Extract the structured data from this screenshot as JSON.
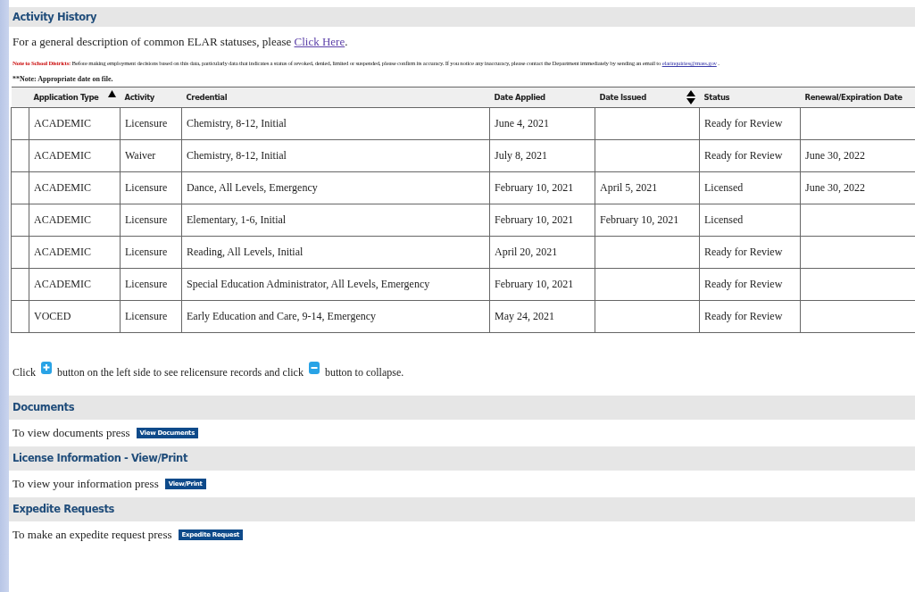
{
  "activity_history": {
    "title": "Activity History",
    "intro": {
      "text": "For a general description of common ELAR statuses, please",
      "link": "Click Here",
      "after": "."
    },
    "note": {
      "label": "Note to School Districts:",
      "text": "Before making employment decisions based on this data, particularly data that indicates a status of revoked, denied, limited or suspended, please confirm its accuracy. If you notice any inaccuracy, please contact the Department immediately by sending an email to",
      "email": "elarinquiries@mass.gov",
      "after": "."
    },
    "date_note": "**Note: Appropriate date on file.",
    "table": {
      "columns": [
        {
          "label": "Application Type",
          "sorted": true
        },
        {
          "label": "Activity",
          "sorted": false,
          "sortable": false
        },
        {
          "label": "Credential",
          "sorted": false,
          "sortable": false
        },
        {
          "label": "Date Applied",
          "sorted": false,
          "sortable": false
        },
        {
          "label": "Date Issued",
          "sorted": false,
          "sortable": true
        },
        {
          "label": "Status",
          "sorted": false,
          "sortable": false
        },
        {
          "label": "Renewal/Expiration Date",
          "sorted": false,
          "sortable": false
        }
      ],
      "rows": [
        [
          "ACADEMIC",
          "Licensure",
          "Chemistry, 8-12, Initial",
          "June 4, 2021",
          "",
          "Ready for Review",
          ""
        ],
        [
          "ACADEMIC",
          "Waiver",
          "Chemistry, 8-12, Initial",
          "July 8, 2021",
          "",
          "Ready for Review",
          "June 30, 2022"
        ],
        [
          "ACADEMIC",
          "Licensure",
          "Dance, All Levels, Emergency",
          "February 10, 2021",
          "April 5, 2021",
          "Licensed",
          "June 30, 2022"
        ],
        [
          "ACADEMIC",
          "Licensure",
          "Elementary, 1-6, Initial",
          "February 10, 2021",
          "February 10, 2021",
          "Licensed",
          ""
        ],
        [
          "ACADEMIC",
          "Licensure",
          "Reading, All Levels, Initial",
          "April 20, 2021",
          "",
          "Ready for Review",
          ""
        ],
        [
          "ACADEMIC",
          "Licensure",
          "Special Education Administrator, All Levels, Emergency",
          "February 10, 2021",
          "",
          "Ready for Review",
          ""
        ],
        [
          "VOCED",
          "Licensure",
          "Early Education and Care, 9-14, Emergency",
          "May 24, 2021",
          "",
          "Ready for Review",
          ""
        ]
      ]
    },
    "help": {
      "before": "Click",
      "middle": "button on the left side to see relicensure records and click",
      "after": "button to collapse."
    }
  },
  "sections": [
    {
      "title": "Documents",
      "text": "To view documents press",
      "button": "View Documents"
    },
    {
      "title": "License Information - View/Print",
      "text": "To view your information press",
      "button": "View/Print"
    },
    {
      "title": "Expedite Requests",
      "text": "To make an expedite request press",
      "button": "Expedite Request"
    }
  ]
}
